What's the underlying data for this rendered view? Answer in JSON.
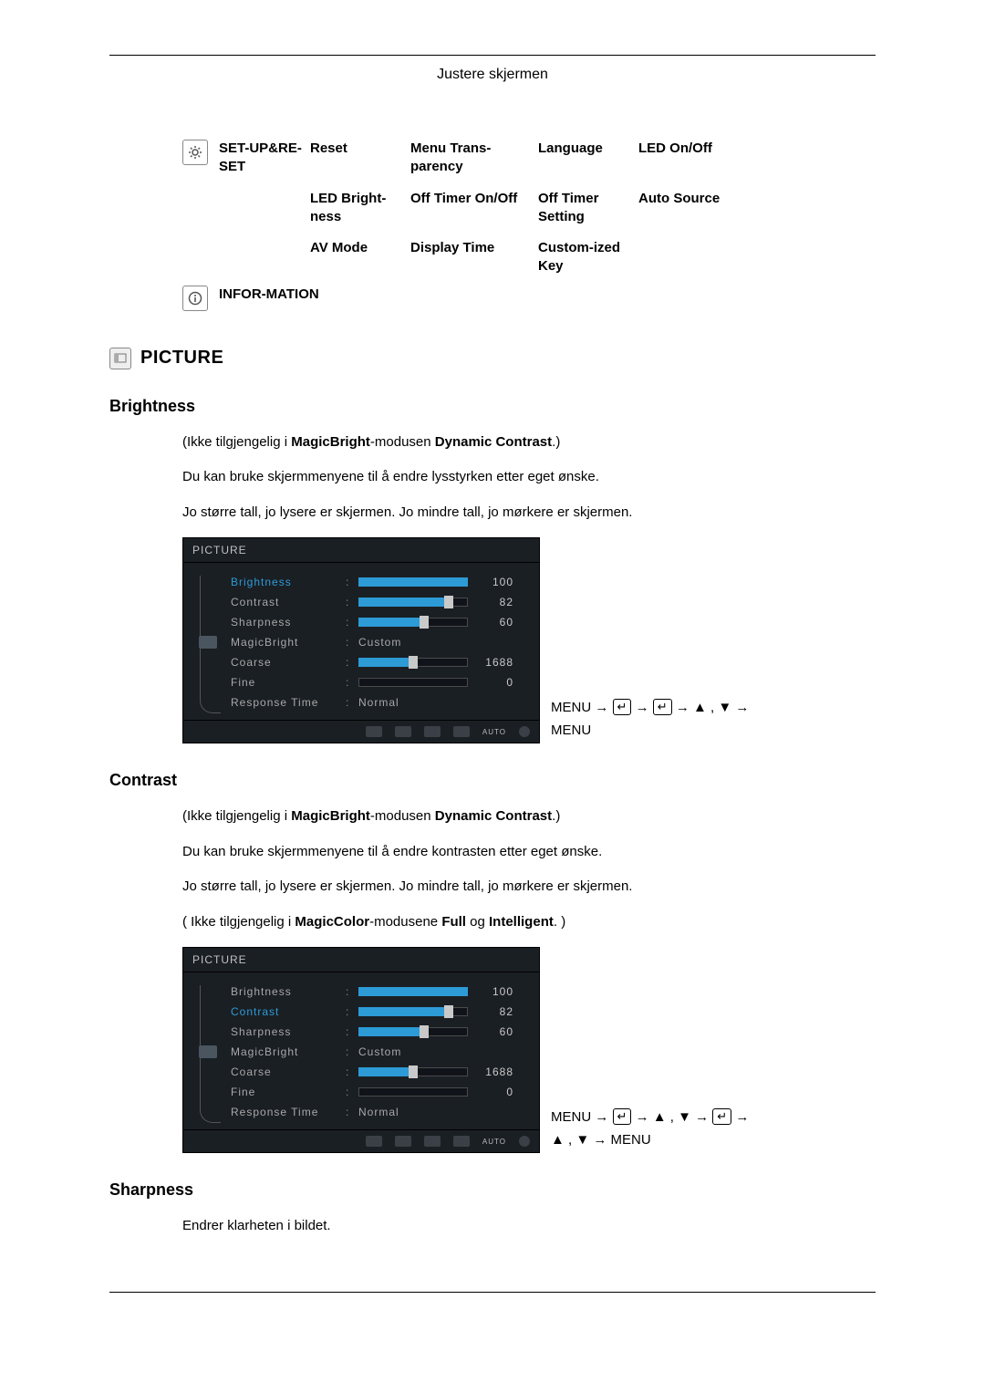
{
  "header_title": "Justere skjermen",
  "setup_table": {
    "row1": {
      "c1": "SET-UP&RE-SET",
      "c2": "Reset",
      "c3": "Menu Trans-parency",
      "c4": "Language",
      "c5": "LED On/Off"
    },
    "row2": {
      "c1": "",
      "c2": "LED Bright-ness",
      "c3": "Off Timer On/Off",
      "c4": "Off Timer Setting",
      "c5": "Auto Source"
    },
    "row3": {
      "c1": "",
      "c2": "AV Mode",
      "c3": "Display Time",
      "c4": "Custom-ized Key",
      "c5": ""
    }
  },
  "information_label": "INFOR-MATION",
  "picture_section_title": "PICTURE",
  "brightness": {
    "heading": "Brightness",
    "p1_pre": "(Ikke tilgjengelig i ",
    "p1_b1": "MagicBright",
    "p1_mid": "-modusen ",
    "p1_b2": "Dynamic Contrast",
    "p1_post": ".)",
    "p2": "Du kan bruke skjermmenyene til å endre lysstyrken etter eget ønske.",
    "p3": "Jo større tall, jo lysere er skjermen. Jo mindre tall, jo mørkere er skjermen."
  },
  "contrast": {
    "heading": "Contrast",
    "p1_pre": "(Ikke tilgjengelig i ",
    "p1_b1": "MagicBright",
    "p1_mid": "-modusen ",
    "p1_b2": "Dynamic Contrast",
    "p1_post": ".)",
    "p2": "Du kan bruke skjermmenyene til å endre kontrasten etter eget ønske.",
    "p3": "Jo større tall, jo lysere er skjermen. Jo mindre tall, jo mørkere er skjermen.",
    "p4_pre": "( Ikke tilgjengelig i ",
    "p4_b1": "MagicColor",
    "p4_mid": "-modusene ",
    "p4_b2": "Full",
    "p4_mid2": " og ",
    "p4_b3": "Intelligent",
    "p4_post": ". )"
  },
  "sharpness": {
    "heading": "Sharpness",
    "p1": "Endrer klarheten i bildet."
  },
  "osd": {
    "title": "PICTURE",
    "items": [
      {
        "label": "Brightness",
        "value": 100,
        "pct": 100,
        "type": "bar"
      },
      {
        "label": "Contrast",
        "value": 82,
        "pct": 82,
        "type": "bar-thumb"
      },
      {
        "label": "Sharpness",
        "value": 60,
        "pct": 60,
        "type": "bar-thumb"
      },
      {
        "label": "MagicBright",
        "value": "Custom",
        "type": "text"
      },
      {
        "label": "Coarse",
        "value": 1688,
        "pct": 50,
        "type": "bar-thumb"
      },
      {
        "label": "Fine",
        "value": 0,
        "pct": 0,
        "type": "bar-empty"
      },
      {
        "label": "Response Time",
        "value": "Normal",
        "type": "text"
      }
    ],
    "selected_brightness_idx": 0,
    "selected_contrast_idx": 1
  },
  "seq1_line1": "MENU → ↵ → ↵ → ▲ , ▼ →",
  "seq1_line2": "MENU",
  "seq2_line1": "MENU → ↵ → ▲ , ▼ → ↵ →",
  "seq2_line2": "▲ , ▼ → MENU"
}
